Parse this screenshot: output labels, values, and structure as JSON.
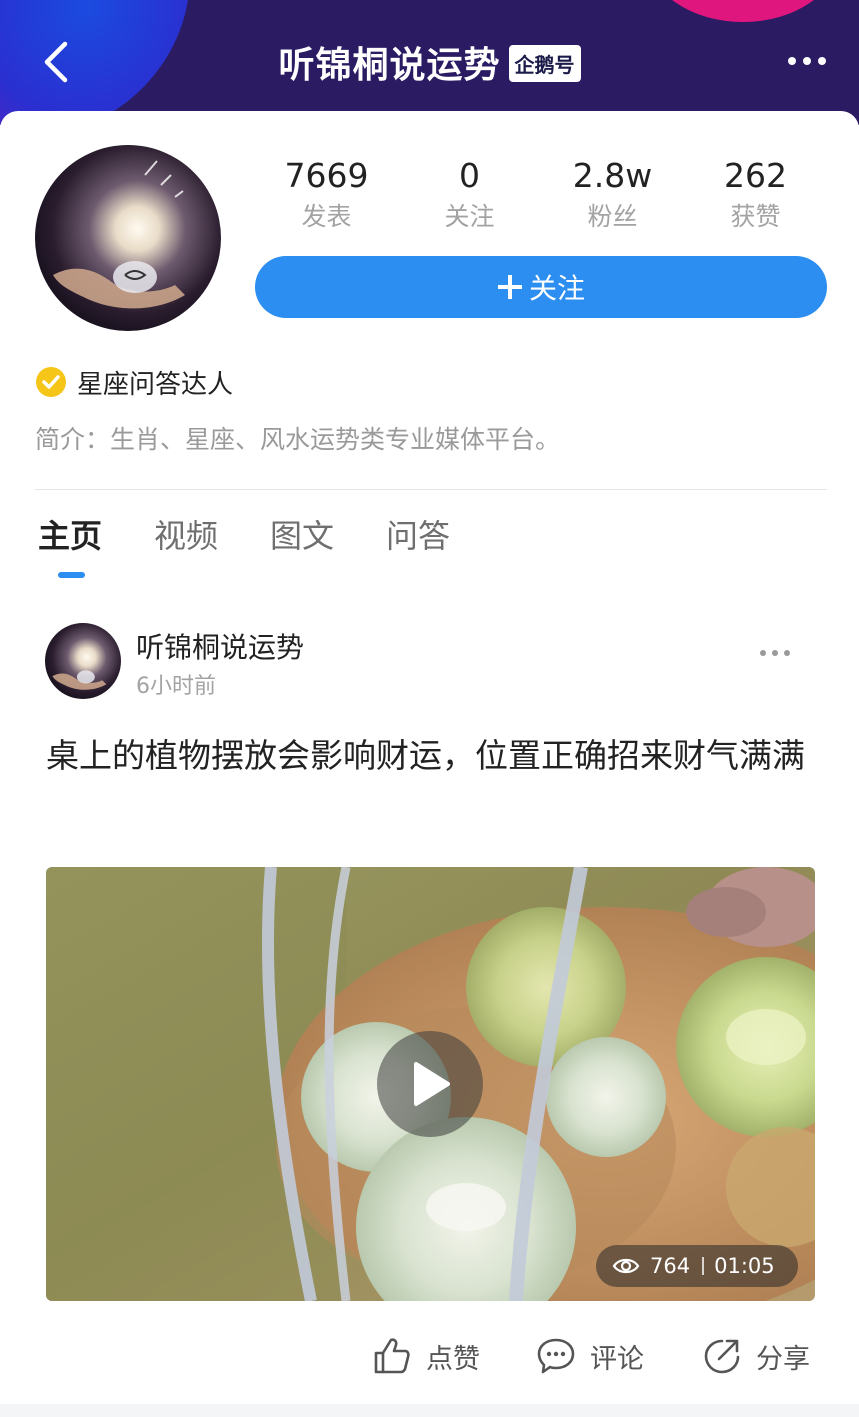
{
  "header": {
    "title": "听锦桐说运势",
    "badge": "企鹅号"
  },
  "profile": {
    "stats": [
      {
        "value": "7669",
        "label": "发表"
      },
      {
        "value": "0",
        "label": "关注"
      },
      {
        "value": "2.8w",
        "label": "粉丝"
      },
      {
        "value": "262",
        "label": "获赞"
      }
    ],
    "follow_button": "关注",
    "verification": "星座问答达人",
    "intro": "简介：生肖、星座、风水运势类专业媒体平台。"
  },
  "tabs": [
    "主页",
    "视频",
    "图文",
    "问答"
  ],
  "post": {
    "author": "听锦桐说运势",
    "time": "6小时前",
    "title": "桌上的植物摆放会影响财运，位置正确招来财气满满",
    "video": {
      "views": "764",
      "duration": "01:05"
    },
    "actions": {
      "like": "点赞",
      "comment": "评论",
      "share": "分享"
    }
  },
  "colors": {
    "header_bg": "#2a1b63",
    "accent": "#2b8ef0",
    "verify_badge": "#f5c518"
  }
}
